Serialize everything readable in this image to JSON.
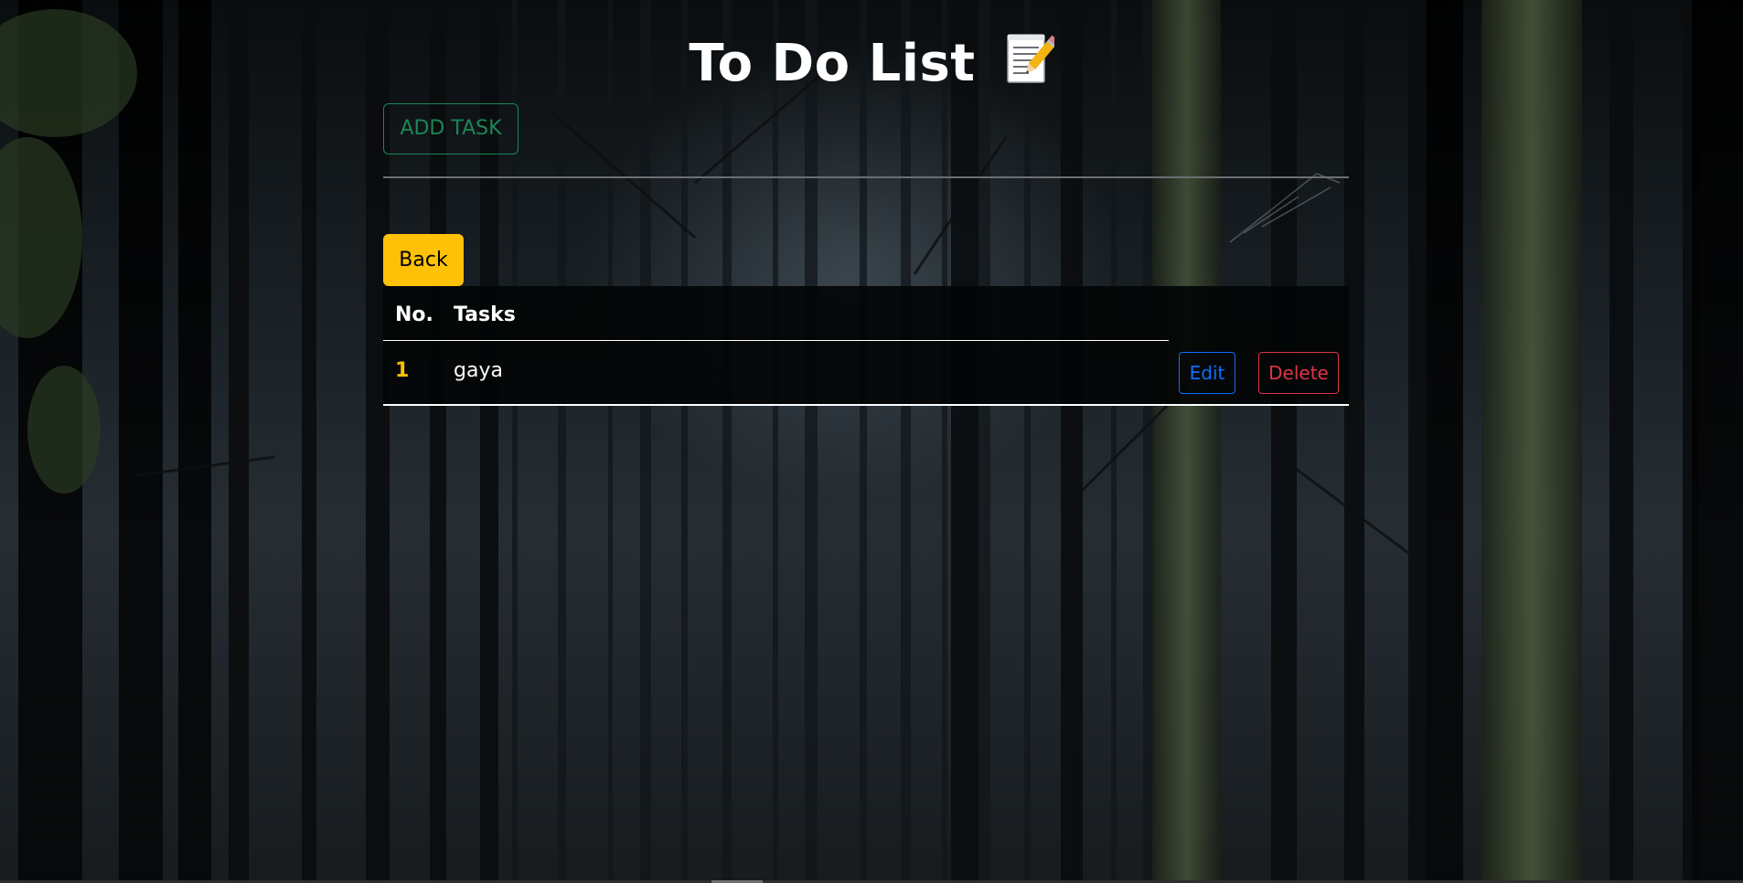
{
  "header": {
    "title": "To Do List"
  },
  "toolbar": {
    "add_task_label": "ADD TASK",
    "back_label": "Back"
  },
  "table": {
    "columns": [
      "No.",
      "Tasks"
    ],
    "rows": [
      {
        "no": "1",
        "task": "gaya",
        "edit_label": "Edit",
        "delete_label": "Delete"
      }
    ]
  },
  "colors": {
    "add_task": "#198754",
    "back": "#ffc107",
    "edit": "#0d6efd",
    "delete": "#dc3545",
    "row_number": "#ffc107"
  },
  "icons": {
    "title_icon": "memo-icon",
    "background": "forest-background-image"
  }
}
